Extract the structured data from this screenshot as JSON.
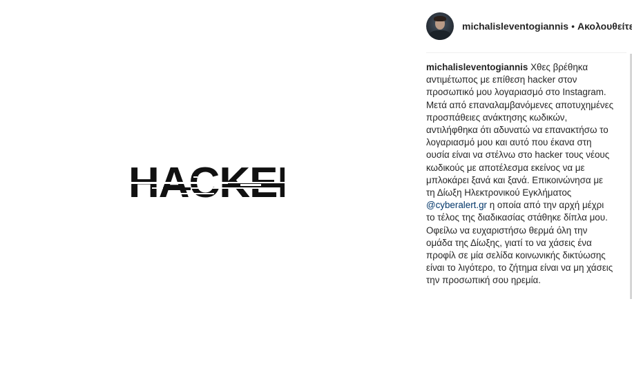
{
  "post": {
    "image": {
      "alt_word": "HACKED"
    },
    "header": {
      "username": "michalisleventogiannis",
      "separator": "•",
      "follow_label": "Ακολουθείτε"
    },
    "caption": {
      "username": "michalisleventogiannis",
      "text_before_mention": "Χθες βρέθηκα αντιμέτωπος με επίθεση hacker στον προσωπικό μου λογαριασμό στο Instagram. Μετά από επαναλαμβανόμενες αποτυχημένες προσπάθειες ανάκτησης κωδικών, αντιλήφθηκα ότι αδυνατώ να επανακτήσω το λογαριασμό μου και αυτό που έκανα στη ουσία είναι να στέλνω στο hacker τους νέους κωδικούς με αποτέλεσμα εκείνος να με μπλοκάρει ξανά και ξανά. Επικοινώνησα με τη Δίωξη Ηλεκτρονικού Εγκλήματος",
      "mention": "@cyberalert.gr",
      "text_after_mention": "η οποία από την αρχή μέχρι το τέλος της διαδικασίας στάθηκε δίπλα μου. Οφείλω να ευχαριστήσω θερμά όλη την ομάδα της Δίωξης, γιατί το να χάσεις ένα προφίλ σε μία σελίδα κοινωνικής δικτύωσης είναι το λιγότερο, το ζήτημα είναι να μη χάσεις την προσωπική σου ηρεμία."
    },
    "colors": {
      "text": "#262626",
      "mention": "#003569",
      "divider": "#efefef"
    }
  }
}
